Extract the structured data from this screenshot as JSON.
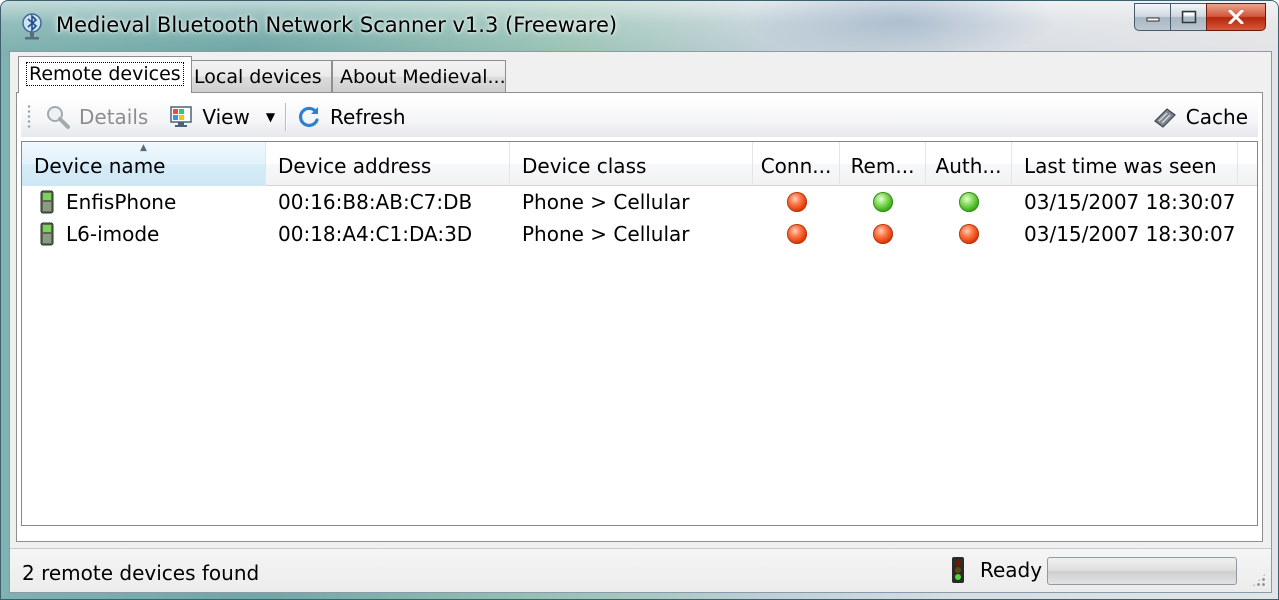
{
  "window": {
    "title": "Medieval Bluetooth Network Scanner v1.3 (Freeware)"
  },
  "tabs": [
    {
      "label": "Remote devices",
      "active": true
    },
    {
      "label": "Local devices",
      "active": false
    },
    {
      "label": "About Medieval...",
      "active": false
    }
  ],
  "toolbar": {
    "details_label": "Details",
    "details_enabled": false,
    "view_label": "View",
    "refresh_label": "Refresh",
    "cache_label": "Cache"
  },
  "list": {
    "columns": [
      {
        "label": "Device name",
        "sorted": "ascending"
      },
      {
        "label": "Device address"
      },
      {
        "label": "Device class"
      },
      {
        "label": "Conn..."
      },
      {
        "label": "Rem..."
      },
      {
        "label": "Auth..."
      },
      {
        "label": "Last time was seen"
      }
    ],
    "rows": [
      {
        "name": "EnfisPhone",
        "address": "00:16:B8:AB:C7:DB",
        "class": "Phone > Cellular",
        "connected": "red",
        "remembered": "green",
        "authenticated": "green",
        "last_seen": "03/15/2007 18:30:07"
      },
      {
        "name": "L6-imode",
        "address": "00:18:A4:C1:DA:3D",
        "class": "Phone > Cellular",
        "connected": "red",
        "remembered": "red",
        "authenticated": "red",
        "last_seen": "03/15/2007 18:30:07"
      }
    ]
  },
  "status": {
    "text": "2 remote devices found",
    "state": "Ready",
    "progress": 0
  },
  "colors": {
    "status_red": "#df3c0a",
    "status_green": "#3eb11a",
    "sorted_header": "#d5ebf8"
  }
}
